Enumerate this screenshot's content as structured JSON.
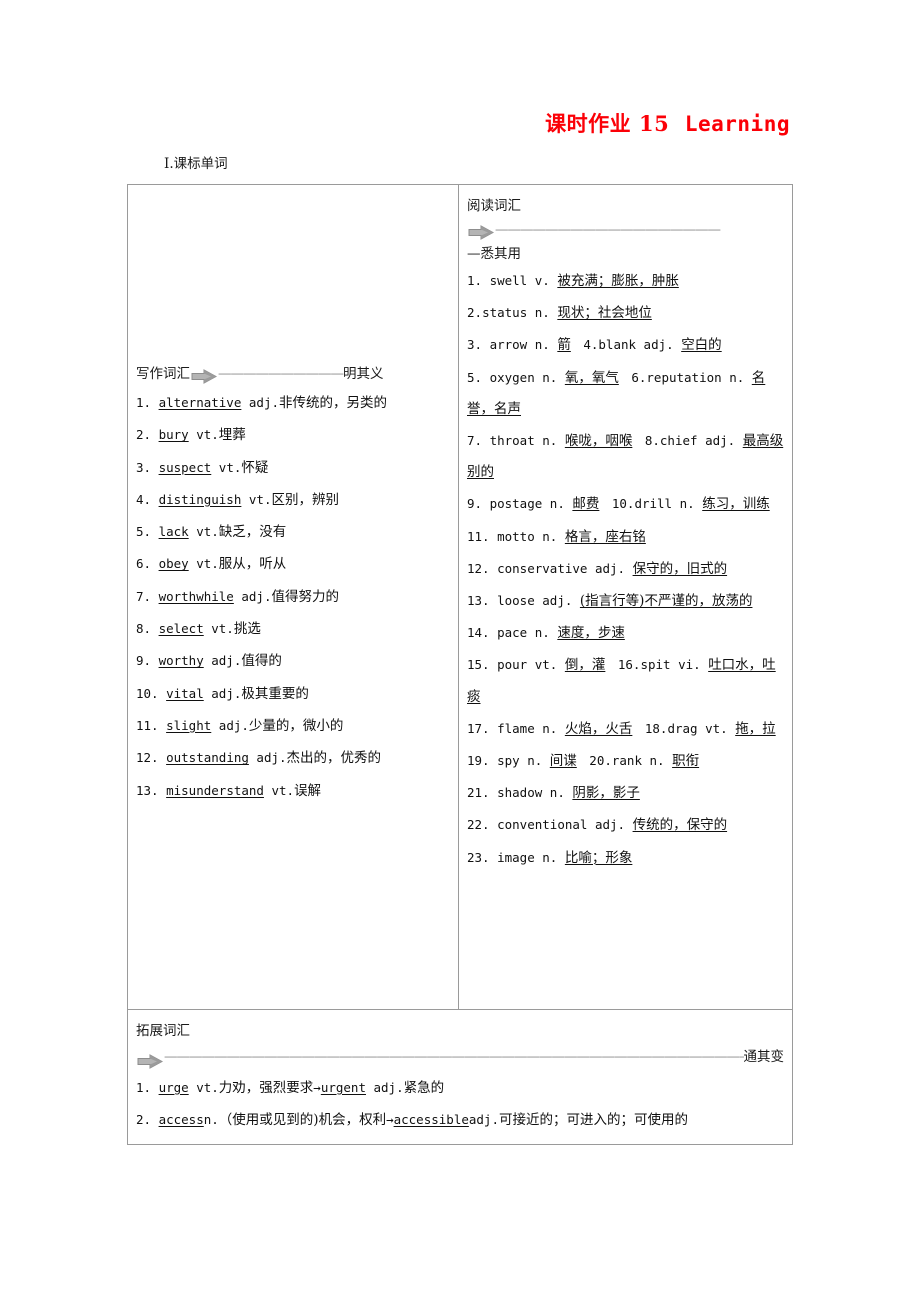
{
  "page": {
    "title_cn": "课时作业 15",
    "title_en": "Learning",
    "title_color": "#fb0007",
    "section_heading": "Ⅰ.课标单词"
  },
  "writing": {
    "label": "写作词汇",
    "arrow_icon": "right-arrow-icon",
    "dashes": "——————————",
    "tail": "明其义",
    "items": [
      {
        "num": "1.",
        "word": "alternative",
        "pos": " adj.",
        "def": "非传统的，另类的"
      },
      {
        "num": "2.",
        "word": "bury",
        "pos": " vt.",
        "def": "埋葬"
      },
      {
        "num": "3.",
        "word": "suspect",
        "pos": " vt.",
        "def": "怀疑"
      },
      {
        "num": "4.",
        "word": "distinguish",
        "pos": " vt.",
        "def": "区别，辨别"
      },
      {
        "num": "5.",
        "word": "lack",
        "pos": " vt.",
        "def": "缺乏，没有"
      },
      {
        "num": "6.",
        "word": "obey",
        "pos": " vt.",
        "def": "服从，听从"
      },
      {
        "num": "7.",
        "word": "worthwhile",
        "pos": " adj.",
        "def": "值得努力的"
      },
      {
        "num": "8.",
        "word": "select",
        "pos": " vt.",
        "def": "挑选"
      },
      {
        "num": "9.",
        "word": "worthy",
        "pos": " adj.",
        "def": "值得的"
      },
      {
        "num": "10.",
        "word": "vital",
        "pos": " adj.",
        "def": "极其重要的"
      },
      {
        "num": "11.",
        "word": "slight",
        "pos": " adj.",
        "def": "少量的，微小的"
      },
      {
        "num": "12.",
        "word": "outstanding",
        "pos": " adj.",
        "def": "杰出的，优秀的"
      },
      {
        "num": "13.",
        "word": "misunderstand",
        "pos": " vt.",
        "def": "误解"
      }
    ]
  },
  "reading": {
    "label": "阅读词汇",
    "arrow_icon": "right-arrow-icon",
    "dashes": "——————————————————",
    "tail": "—悉其用",
    "lines": [
      "1. swell v. 被充满；膨胀，肿胀",
      "2.status n. 现状；社会地位",
      "3. arrow n. 箭　4.blank adj. 空白的",
      "5. oxygen n. 氧，氧气　6.reputation n. 名誉，名声",
      "7. throat n. 喉咙，咽喉　8.chief adj. 最高级别的",
      "9. postage n. 邮费　10.drill n. 练习，训练",
      "11. motto n. 格言，座右铭",
      "12. conservative adj. 保守的，旧式的",
      "13. loose adj. (指言行等)不严谨的，放荡的",
      "14. pace n. 速度，步速",
      "15. pour vt. 倒，灌　16.spit vi. 吐口水，吐痰",
      "17. flame n. 火焰，火舌　18.drag vt. 拖，拉",
      "19. spy n. 间谍　20.rank n. 职衔",
      "21. shadow n. 阴影，影子",
      "22. conventional adj. 传统的，保守的",
      "23. image n. 比喻；形象"
    ],
    "items": [
      {
        "segs": [
          {
            "t": "1. ",
            "s": "en"
          },
          {
            "t": "swell",
            "s": "en"
          },
          {
            "t": " v. ",
            "s": "en"
          },
          {
            "t": "被充满；膨胀，肿胀",
            "s": "u"
          }
        ]
      },
      {
        "segs": [
          {
            "t": "2.",
            "s": "en"
          },
          {
            "t": "status",
            "s": "en"
          },
          {
            "t": " n. ",
            "s": "en"
          },
          {
            "t": "现状；社会地位",
            "s": "u"
          }
        ]
      },
      {
        "segs": [
          {
            "t": "3. ",
            "s": "en"
          },
          {
            "t": "arrow",
            "s": "en"
          },
          {
            "t": " n. ",
            "s": "en"
          },
          {
            "t": "箭",
            "s": "u"
          },
          {
            "t": "　4.",
            "s": "en"
          },
          {
            "t": "blank",
            "s": "en"
          },
          {
            "t": " adj. ",
            "s": "en"
          },
          {
            "t": "空白的",
            "s": "u"
          }
        ]
      },
      {
        "segs": [
          {
            "t": "5. ",
            "s": "en"
          },
          {
            "t": "oxygen",
            "s": "en"
          },
          {
            "t": " n. ",
            "s": "en"
          },
          {
            "t": "氧，氧气",
            "s": "u"
          },
          {
            "t": "　6.",
            "s": "en"
          },
          {
            "t": "reputation",
            "s": "en"
          },
          {
            "t": " n. ",
            "s": "en"
          },
          {
            "t": "名誉，名声",
            "s": "u"
          }
        ]
      },
      {
        "segs": [
          {
            "t": "7. ",
            "s": "en"
          },
          {
            "t": "throat",
            "s": "en"
          },
          {
            "t": " n. ",
            "s": "en"
          },
          {
            "t": "喉咙，咽喉",
            "s": "u"
          },
          {
            "t": "　8.",
            "s": "en"
          },
          {
            "t": "chief",
            "s": "en"
          },
          {
            "t": " adj. ",
            "s": "en"
          },
          {
            "t": "最高级别的",
            "s": "u"
          }
        ]
      },
      {
        "segs": [
          {
            "t": "9. ",
            "s": "en"
          },
          {
            "t": "postage",
            "s": "en"
          },
          {
            "t": " n. ",
            "s": "en"
          },
          {
            "t": "邮费",
            "s": "u"
          },
          {
            "t": "　10.",
            "s": "en"
          },
          {
            "t": "drill",
            "s": "en"
          },
          {
            "t": " n. ",
            "s": "en"
          },
          {
            "t": "练习，训练",
            "s": "u"
          }
        ]
      },
      {
        "segs": [
          {
            "t": "11. ",
            "s": "en"
          },
          {
            "t": "motto",
            "s": "en"
          },
          {
            "t": " n. ",
            "s": "en"
          },
          {
            "t": "格言，座右铭",
            "s": "u"
          }
        ]
      },
      {
        "segs": [
          {
            "t": "12. ",
            "s": "en"
          },
          {
            "t": "conservative",
            "s": "en"
          },
          {
            "t": " adj. ",
            "s": "en"
          },
          {
            "t": "保守的，旧式的",
            "s": "u"
          }
        ]
      },
      {
        "segs": [
          {
            "t": "13. ",
            "s": "en"
          },
          {
            "t": "loose",
            "s": "en"
          },
          {
            "t": " adj. ",
            "s": "en"
          },
          {
            "t": "(指言行等)不严谨的，放荡的",
            "s": "u"
          }
        ]
      },
      {
        "segs": [
          {
            "t": "14. ",
            "s": "en"
          },
          {
            "t": "pace",
            "s": "en"
          },
          {
            "t": " n. ",
            "s": "en"
          },
          {
            "t": "速度，步速",
            "s": "u"
          }
        ]
      },
      {
        "segs": [
          {
            "t": "15. ",
            "s": "en"
          },
          {
            "t": "pour",
            "s": "en"
          },
          {
            "t": " vt. ",
            "s": "en"
          },
          {
            "t": "倒，灌",
            "s": "u"
          },
          {
            "t": "　16.",
            "s": "en"
          },
          {
            "t": "spit",
            "s": "en"
          },
          {
            "t": " vi. ",
            "s": "en"
          },
          {
            "t": "吐口水，吐痰",
            "s": "u"
          }
        ]
      },
      {
        "segs": [
          {
            "t": "17. ",
            "s": "en"
          },
          {
            "t": "flame",
            "s": "en"
          },
          {
            "t": " n. ",
            "s": "en"
          },
          {
            "t": "火焰，火舌",
            "s": "u"
          },
          {
            "t": "　18.",
            "s": "en"
          },
          {
            "t": "drag",
            "s": "en"
          },
          {
            "t": " vt. ",
            "s": "en"
          },
          {
            "t": "拖，拉",
            "s": "u"
          }
        ]
      },
      {
        "segs": [
          {
            "t": "19. ",
            "s": "en"
          },
          {
            "t": "spy",
            "s": "en"
          },
          {
            "t": " n. ",
            "s": "en"
          },
          {
            "t": "间谍",
            "s": "u"
          },
          {
            "t": "　20.",
            "s": "en"
          },
          {
            "t": "rank",
            "s": "en"
          },
          {
            "t": " n. ",
            "s": "en"
          },
          {
            "t": "职衔",
            "s": "u"
          }
        ]
      },
      {
        "segs": [
          {
            "t": "21. ",
            "s": "en"
          },
          {
            "t": "shadow",
            "s": "en"
          },
          {
            "t": " n. ",
            "s": "en"
          },
          {
            "t": "阴影，影子",
            "s": "u"
          }
        ]
      },
      {
        "segs": [
          {
            "t": "22. ",
            "s": "en"
          },
          {
            "t": "conventional",
            "s": "en"
          },
          {
            "t": " adj. ",
            "s": "en"
          },
          {
            "t": "传统的，保守的",
            "s": "u"
          }
        ]
      },
      {
        "segs": [
          {
            "t": "23. ",
            "s": "en"
          },
          {
            "t": "image",
            "s": "en"
          },
          {
            "t": " n. ",
            "s": "en"
          },
          {
            "t": "比喻；形象",
            "s": "u"
          }
        ]
      }
    ]
  },
  "extension": {
    "label": "拓展词汇",
    "arrow_icon": "right-arrow-icon",
    "dashes": "————————————————————————————————————————————————",
    "tail": "通其变",
    "items": [
      {
        "num": "1. ",
        "word": "urge",
        "pos": " vt.",
        "def": "力劝，强烈要求",
        "arrow": "→",
        "word2": "urgent",
        "pos2": " adj.",
        "def2": "紧急的"
      },
      {
        "num": "2. ",
        "word": "access",
        "pos": "n.",
        "def": "（使用或见到的)机会，权利",
        "arrow": "→",
        "word2": "accessible",
        "pos2": "adj.",
        "def2": "可接近的；可进入的；可使用的"
      }
    ]
  }
}
